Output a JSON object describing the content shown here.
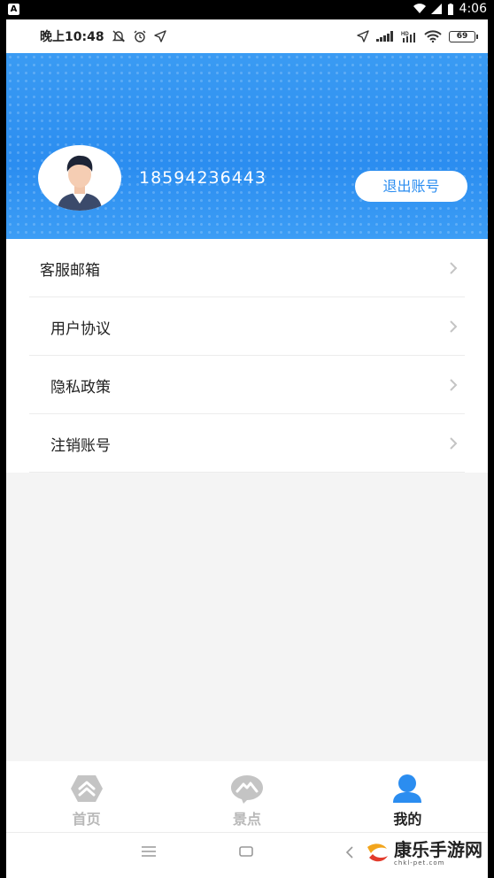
{
  "system_bar": {
    "time": "4:06"
  },
  "status_bar": {
    "time": "晚上10:48",
    "battery": "69"
  },
  "profile": {
    "phone": "18594236443",
    "logout_label": "退出账号"
  },
  "menu": [
    {
      "label": "客服邮箱"
    },
    {
      "label": "用户协议"
    },
    {
      "label": "隐私政策"
    },
    {
      "label": "注销账号"
    }
  ],
  "tabs": [
    {
      "label": "首页",
      "icon": "home-icon",
      "active": false
    },
    {
      "label": "景点",
      "icon": "scenic-spot-icon",
      "active": false
    },
    {
      "label": "我的",
      "icon": "profile-icon",
      "active": true
    }
  ],
  "watermark": {
    "text": "康乐手游网",
    "sub": "chkl-pet.com"
  },
  "colors": {
    "primary": "#2b8df0",
    "tab_inactive": "#b8b8b8",
    "tab_active": "#222222"
  }
}
